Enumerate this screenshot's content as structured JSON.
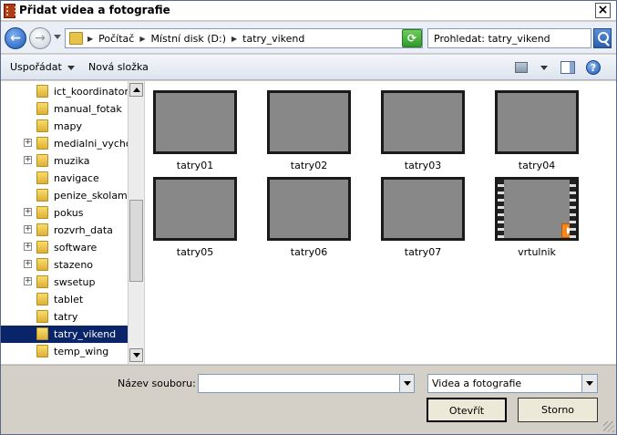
{
  "window": {
    "title": "Přidat videa a fotografie"
  },
  "address": {
    "crumbs": [
      "Počítač",
      "Místní disk (D:)",
      "tatry_vikend"
    ],
    "search_placeholder": "Prohledat: tatry_vikend"
  },
  "toolbar": {
    "organize_label": "Uspořádat",
    "new_folder_label": "Nová složka"
  },
  "tree": {
    "items": [
      {
        "label": "ict_koordinator",
        "expandable": false,
        "selected": false
      },
      {
        "label": "manual_fotak",
        "expandable": false,
        "selected": false
      },
      {
        "label": "mapy",
        "expandable": false,
        "selected": false
      },
      {
        "label": "medialni_vychova",
        "expandable": true,
        "selected": false
      },
      {
        "label": "muzika",
        "expandable": true,
        "selected": false
      },
      {
        "label": "navigace",
        "expandable": false,
        "selected": false
      },
      {
        "label": "penize_skolam",
        "expandable": false,
        "selected": false
      },
      {
        "label": "pokus",
        "expandable": true,
        "selected": false
      },
      {
        "label": "rozvrh_data",
        "expandable": true,
        "selected": false
      },
      {
        "label": "software",
        "expandable": true,
        "selected": false
      },
      {
        "label": "stazeno",
        "expandable": true,
        "selected": false
      },
      {
        "label": "swsetup",
        "expandable": true,
        "selected": false
      },
      {
        "label": "tablet",
        "expandable": false,
        "selected": false
      },
      {
        "label": "tatry",
        "expandable": false,
        "selected": false
      },
      {
        "label": "tatry_vikend",
        "expandable": false,
        "selected": true
      },
      {
        "label": "temp_wing",
        "expandable": false,
        "selected": false
      }
    ]
  },
  "files": [
    {
      "name": "tatry01",
      "kind": "image"
    },
    {
      "name": "tatry02",
      "kind": "image"
    },
    {
      "name": "tatry03",
      "kind": "image"
    },
    {
      "name": "tatry04",
      "kind": "image"
    },
    {
      "name": "tatry05",
      "kind": "image"
    },
    {
      "name": "tatry06",
      "kind": "image"
    },
    {
      "name": "tatry07",
      "kind": "image"
    },
    {
      "name": "vrtulnik",
      "kind": "video"
    }
  ],
  "bottom": {
    "filename_label": "Název souboru:",
    "filename_value": "",
    "filetype_value": "Videa a fotografie",
    "open_label": "Otevřít",
    "cancel_label": "Storno"
  },
  "colors": {
    "selection": "#0a246a",
    "titlebar": "#ffffff"
  }
}
